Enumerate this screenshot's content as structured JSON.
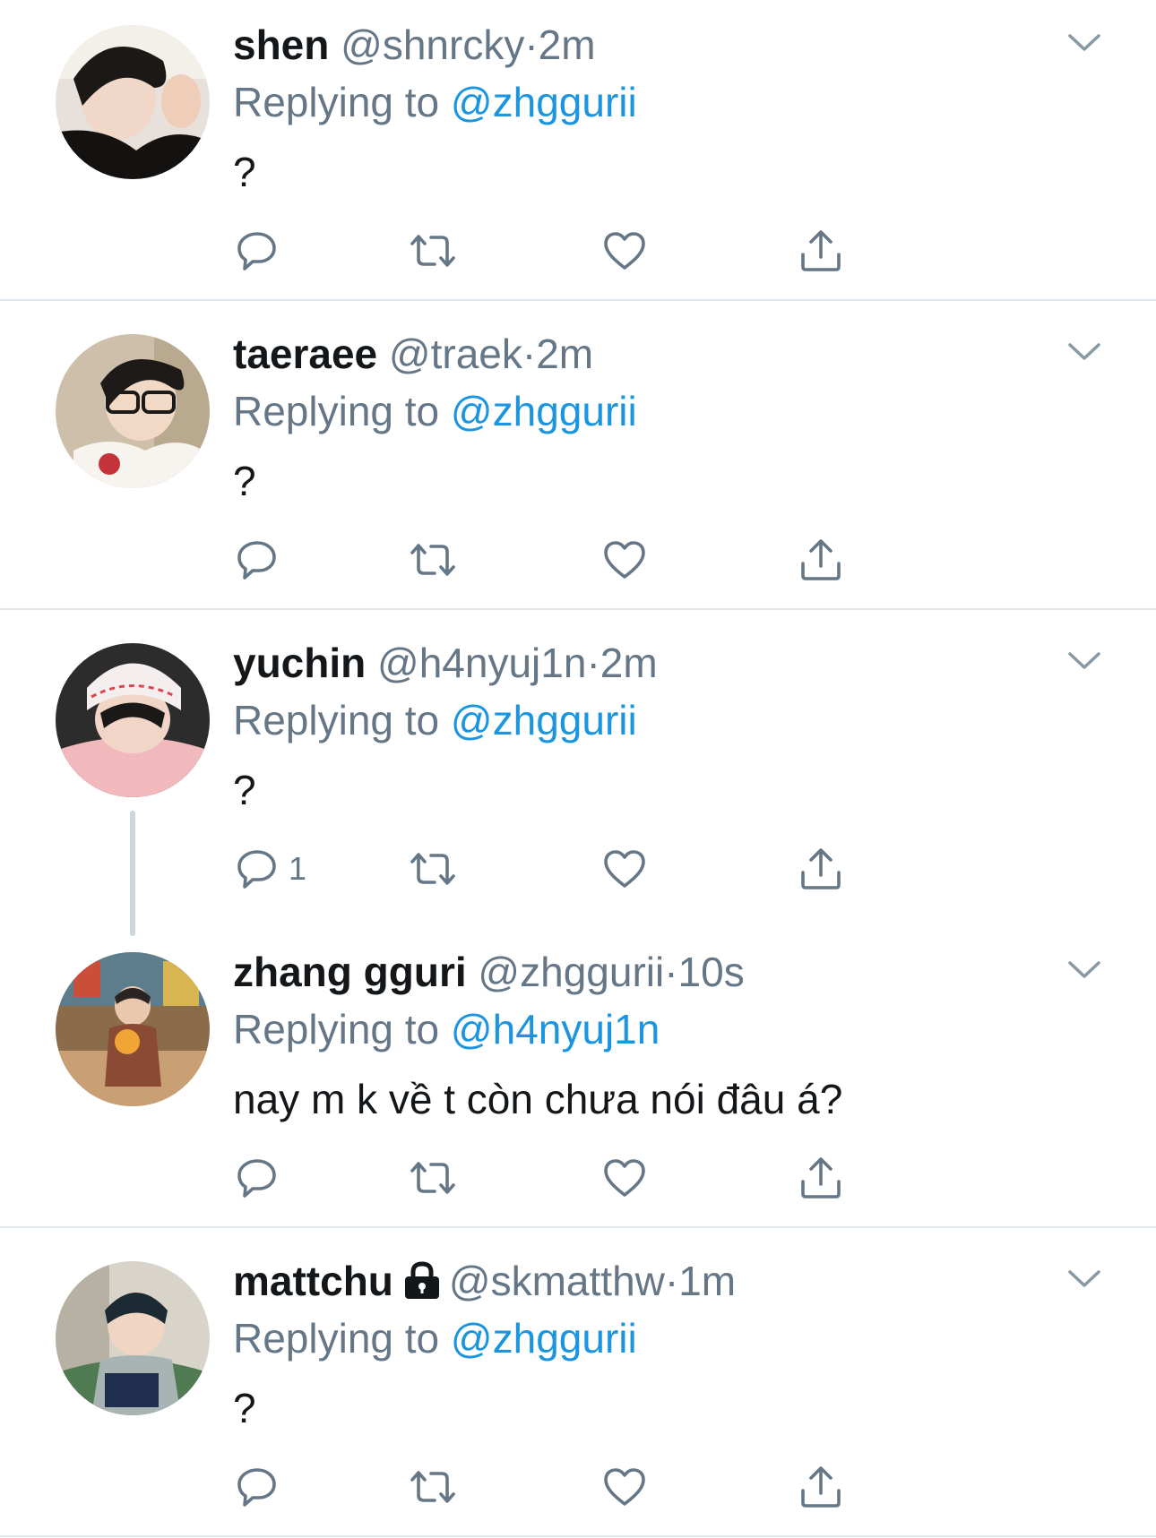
{
  "tweets": [
    {
      "name": "shen",
      "handle": "@shnrcky",
      "dot": "·",
      "time": "2m",
      "replying_prefix": "Replying to",
      "replying_to": "@zhggurii",
      "text": "?",
      "reply_count": ""
    },
    {
      "name": "taeraee",
      "handle": "@traek",
      "dot": "·",
      "time": "2m",
      "replying_prefix": "Replying to",
      "replying_to": "@zhggurii",
      "text": "?",
      "reply_count": ""
    },
    {
      "name": "yuchin",
      "handle": "@h4nyuj1n",
      "dot": "·",
      "time": "2m",
      "replying_prefix": "Replying to",
      "replying_to": "@zhggurii",
      "text": "?",
      "reply_count": "1"
    },
    {
      "name": "zhang gguri",
      "handle": "@zhggurii",
      "dot": "·",
      "time": "10s",
      "replying_prefix": "Replying to",
      "replying_to": "@h4nyuj1n",
      "text": "nay m k về t còn chưa nói đâu á?",
      "reply_count": ""
    },
    {
      "name": "mattchu",
      "handle": "@skmatthw",
      "dot": "·",
      "time": "1m",
      "replying_prefix": "Replying to",
      "replying_to": "@zhggurii",
      "text": "?",
      "reply_count": "",
      "protected": true
    }
  ],
  "colors": {
    "text": "#14171a",
    "secondary": "#657786",
    "link": "#1b95e0",
    "divider": "#e1e8ed",
    "thread_line": "#ccd6dd"
  },
  "icons": [
    "reply-icon",
    "retweet-icon",
    "like-icon",
    "share-icon",
    "chevron-down-icon",
    "lock-icon"
  ]
}
